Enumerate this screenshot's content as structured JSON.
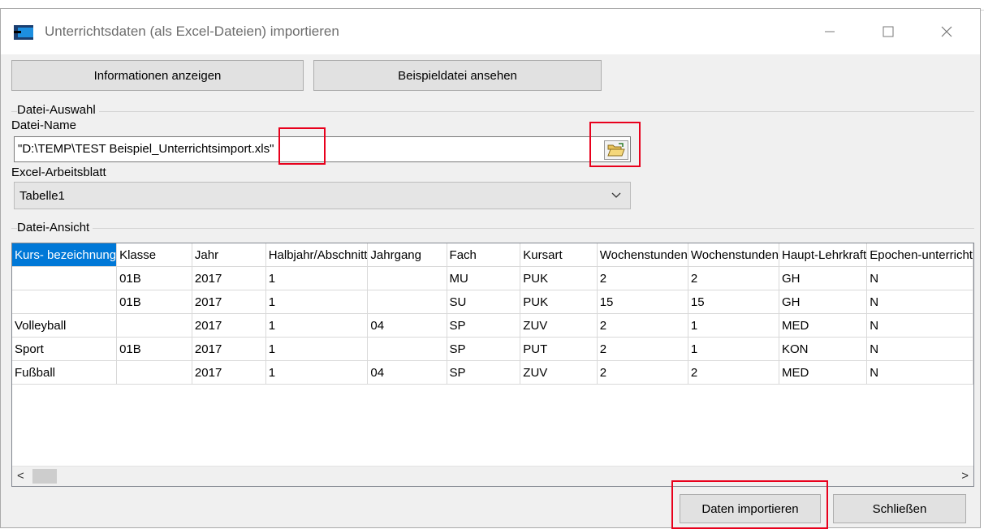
{
  "window": {
    "title": "Unterrichtsdaten (als Excel-Dateien) importieren",
    "controls": {
      "minimize": "—",
      "maximize": "☐",
      "close": "✕"
    }
  },
  "top_buttons": {
    "info_label": "Informationen anzeigen",
    "example_label": "Beispieldatei ansehen"
  },
  "file_selection": {
    "group_label": "Datei-Auswahl",
    "filename_label": "Datei-Name",
    "filename_value": "\"D:\\TEMP\\TEST Beispiel_Unterrichtsimport.xls\"",
    "browse_icon": "folder-open-icon",
    "sheet_label": "Excel-Arbeitsblatt",
    "sheet_value": "Tabelle1"
  },
  "file_view": {
    "group_label": "Datei-Ansicht",
    "columns": [
      "Kurs- bezeichnung",
      "Klasse",
      "Jahr",
      "Halbjahr/Abschnitt",
      "Jahrgang",
      "Fach",
      "Kursart",
      "Wochenstunden",
      "Wochenstunden",
      "Haupt-Lehrkraft",
      "Epochen-unterricht"
    ],
    "rows": [
      [
        "",
        "01B",
        "2017",
        "1",
        "",
        "MU",
        "PUK",
        "2",
        "2",
        "GH",
        "N"
      ],
      [
        "",
        "01B",
        "2017",
        "1",
        "",
        "SU",
        "PUK",
        "15",
        "15",
        "GH",
        "N"
      ],
      [
        "Volleyball",
        "",
        "2017",
        "1",
        "04",
        "SP",
        "ZUV",
        "2",
        "1",
        "MED",
        "N"
      ],
      [
        "Sport",
        "01B",
        "2017",
        "1",
        "",
        "SP",
        "PUT",
        "2",
        "1",
        "KON",
        "N"
      ],
      [
        "Fußball",
        "",
        "2017",
        "1",
        "04",
        "SP",
        "ZUV",
        "2",
        "2",
        "MED",
        "N"
      ]
    ],
    "scroll_left": "<",
    "scroll_right": ">"
  },
  "footer": {
    "import_label": "Daten importieren",
    "close_label": "Schließen"
  },
  "colors": {
    "accent": "#0078d7",
    "highlight": "#e8001c"
  }
}
